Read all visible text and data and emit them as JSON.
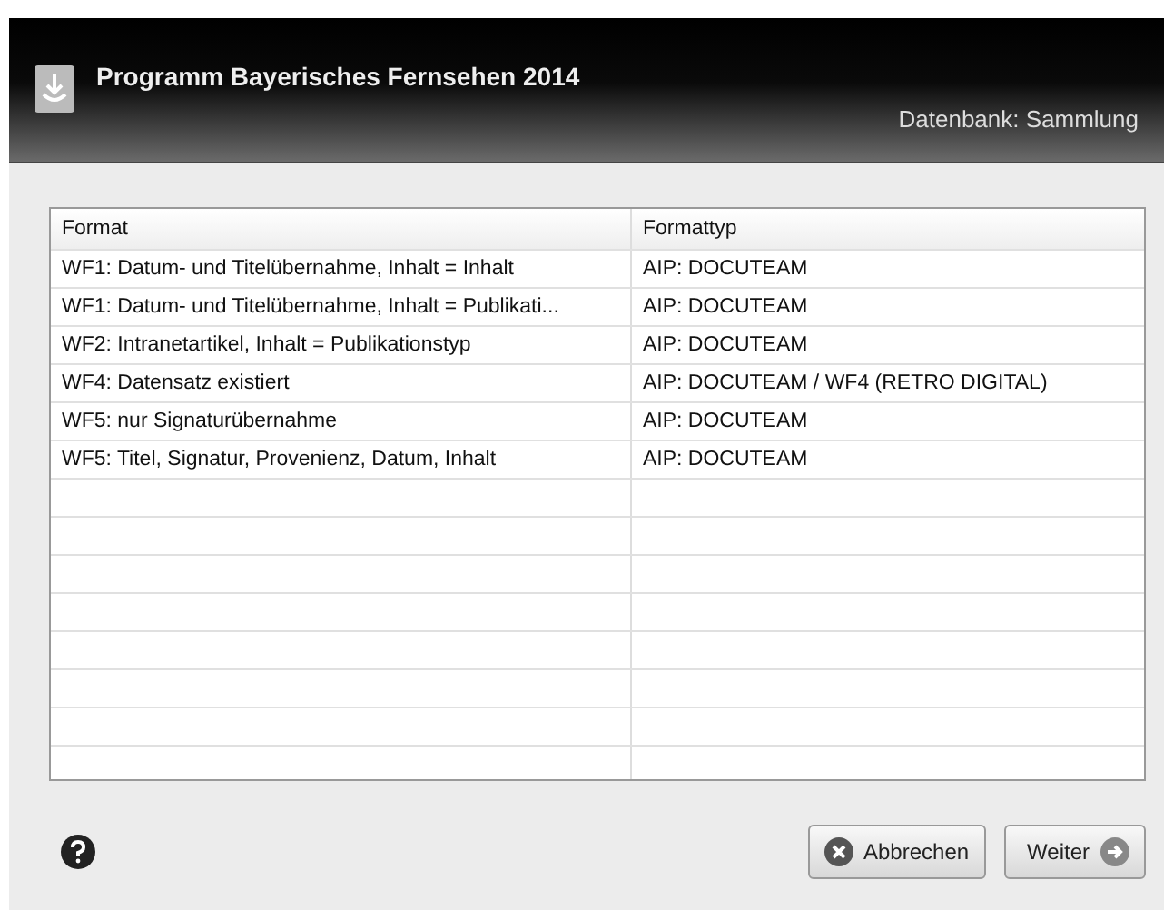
{
  "window": {
    "title": "Programm Bayerisches Fernsehen 2014",
    "database": "Datenbank: Sammlung"
  },
  "table": {
    "columns": [
      "Format",
      "Formattyp"
    ],
    "rows": [
      [
        "WF1: Datum- und Titelübernahme, Inhalt = Inhalt",
        "AIP: DOCUTEAM"
      ],
      [
        "WF1: Datum- und Titelübernahme, Inhalt = Publikati...",
        "AIP: DOCUTEAM"
      ],
      [
        "WF2: Intranetartikel, Inhalt = Publikationstyp",
        "AIP: DOCUTEAM"
      ],
      [
        "WF4: Datensatz existiert",
        "AIP: DOCUTEAM / WF4 (RETRO DIGITAL)"
      ],
      [
        "WF5: nur Signaturübernahme",
        "AIP: DOCUTEAM"
      ],
      [
        "WF5: Titel, Signatur, Provenienz, Datum, Inhalt",
        "AIP: DOCUTEAM"
      ]
    ]
  },
  "buttons": {
    "cancel": "Abbrechen",
    "next": "Weiter"
  }
}
